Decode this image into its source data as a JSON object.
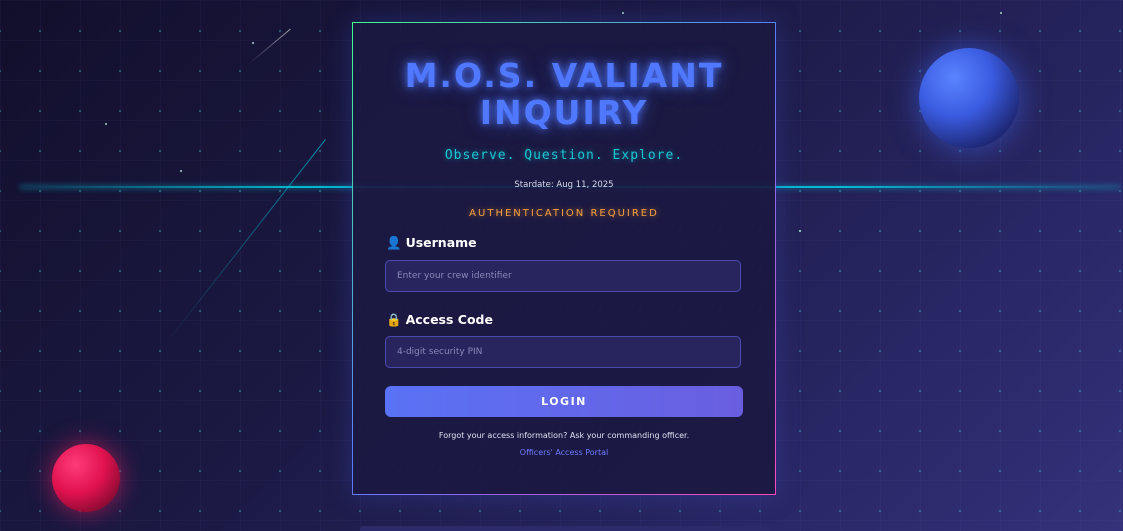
{
  "login": {
    "title": "M.O.S. VALIANT INQUIRY",
    "motto": "Observe. Question. Explore.",
    "stardate": "Stardate: Aug 11, 2025",
    "auth_notice": "AUTHENTICATION REQUIRED",
    "username": {
      "icon": "👤",
      "label": "Username",
      "placeholder": "Enter your crew identifier",
      "value": ""
    },
    "access_code": {
      "icon": "🔒",
      "label": "Access Code",
      "placeholder": "4-digit security PIN",
      "value": ""
    },
    "login_button": "LOGIN",
    "forgot_text": "Forgot your access information? Ask your commanding officer.",
    "portal_link": "Officers' Access Portal"
  },
  "colors": {
    "title": "#4f78ff",
    "motto": "#17c7d2",
    "auth_notice": "#f7a23c",
    "button": "#5a72f5",
    "link": "#6d7cff"
  }
}
